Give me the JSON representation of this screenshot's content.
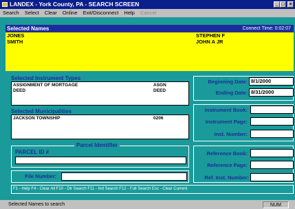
{
  "window": {
    "title": "LANDEX - York County, PA - SEARCH SCREEN",
    "min": "_",
    "max": "□",
    "close": "×"
  },
  "menu": [
    {
      "label": "Search"
    },
    {
      "label": "Select"
    },
    {
      "label": "Clear"
    },
    {
      "label": "Online"
    },
    {
      "label": "Exit/Disconnect"
    },
    {
      "label": "Help"
    },
    {
      "label": "Cancel"
    }
  ],
  "names": {
    "header": "Selected Names",
    "connect": "Connect Time: 0:02:07",
    "rows": [
      {
        "last": "JONES",
        "first": "STEPHEN F"
      },
      {
        "last": "SMITH",
        "first": "JOHN A JR"
      }
    ]
  },
  "instruments": {
    "header": "Selected Instrument Types",
    "rows": [
      {
        "name": "ASSIGNMENT OF MORTGAGE",
        "code": "ASGN"
      },
      {
        "name": "DEED",
        "code": "DEED"
      }
    ]
  },
  "municipalities": {
    "header": "Selected Municipalities",
    "rows": [
      {
        "name": "JACKSON TOWNSHIP",
        "code": "0206"
      }
    ]
  },
  "parcel": {
    "group_label": "Parcel Identifier",
    "label": "PARCEL ID #",
    "value": ""
  },
  "file": {
    "label": "File Number:",
    "value": ""
  },
  "dates": {
    "begin_label": "Beginning Date:",
    "begin_value": "8/1/2000",
    "end_label": "Ending Date:",
    "end_value": "8/31/2000"
  },
  "instrument_fields": {
    "book_label": "Instrument Book:",
    "page_label": "Instrument Page:",
    "num_label": "Inst. Number:"
  },
  "reference": {
    "book_label": "Reference Book:",
    "page_label": "Reference Page:",
    "num_label": "Ref. Inst. Number:"
  },
  "shortcuts": "F1 - Help   F4 - Clear All   F10 - Dir Search   F11 - Ind Search   F12 - Full Search   Esc - Clear Current",
  "status": {
    "text": "Selected Names to search",
    "num": "NUM"
  }
}
